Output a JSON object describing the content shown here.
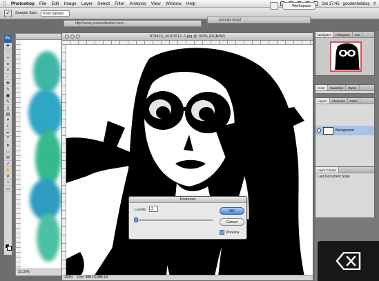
{
  "menubar": {
    "app": "Photoshop",
    "items": [
      "File",
      "Edit",
      "Image",
      "Layer",
      "Select",
      "Filter",
      "Analysis",
      "View",
      "Window",
      "Help"
    ],
    "time": "Sat 17:45",
    "user": "goodonholiday"
  },
  "options": {
    "sample_label": "Sample Size:",
    "sample_value": "Point Sample",
    "workspace": "Workspace"
  },
  "background_windows": {
    "left_title": "http://www.youneedarebel.com/...",
    "right_title": "portraits brutal"
  },
  "document": {
    "title": "870819_34101513 -1.jpg @ 100% (RGB/8#)",
    "zoom": "100%",
    "doc_size": "Doc: 388.1K/388.1K"
  },
  "watercolor_doc": {
    "zoom": "33.33%"
  },
  "dialog": {
    "title": "Posterize",
    "levels_label": "Levels:",
    "levels_value": "2",
    "ok": "OK",
    "cancel": "Cancel",
    "preview": "Preview",
    "preview_checked": true,
    "slider_value": 0
  },
  "panels": {
    "navigator_tabs": [
      "Navigator",
      "Histogram",
      "Info"
    ],
    "color_tabs": [
      "Color",
      "Swatches",
      "Styles"
    ],
    "layers_tabs": [
      "Layers",
      "Channels",
      "Paths"
    ],
    "layer_name": "Background",
    "history_tabs": [
      "Layer Comps"
    ],
    "history_item": "Last Document State"
  },
  "toolbox": {
    "badge": "Ps"
  },
  "colors": {
    "accent": "#4d8ad8",
    "selection": "#a8c3e6"
  }
}
